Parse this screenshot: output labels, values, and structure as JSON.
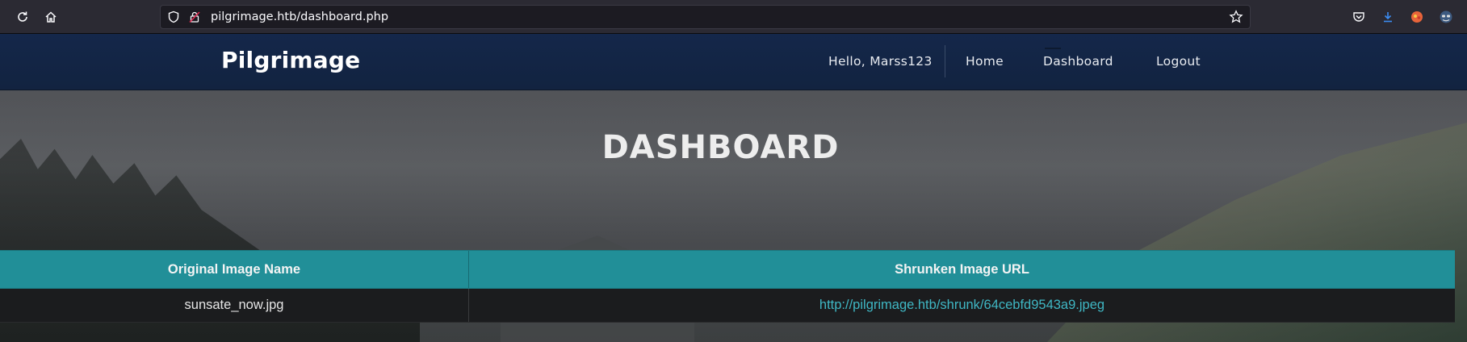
{
  "browser": {
    "url": "pilgrimage.htb/dashboard.php",
    "icons": [
      "reload-icon",
      "home-icon",
      "shield-icon",
      "lock-icon",
      "star-icon",
      "pocket-icon",
      "download-icon",
      "extension-icon",
      "account-icon"
    ]
  },
  "navbar": {
    "brand": "Pilgrimage",
    "greeting": "Hello, Marss123",
    "items": [
      {
        "label": "Home"
      },
      {
        "label": "Dashboard"
      },
      {
        "label": "Logout"
      }
    ]
  },
  "main": {
    "title": "DASHBOARD",
    "table": {
      "headers": [
        "Original Image Name",
        "Shrunken Image URL"
      ],
      "rows": [
        [
          "sunsate_now.jpg",
          "http://pilgrimage.htb/shrunk/64cebfd9543a9.jpeg"
        ]
      ]
    }
  },
  "colors": {
    "navbar": "#14274a",
    "table_header": "#218f98",
    "link": "#3fb7c4"
  }
}
